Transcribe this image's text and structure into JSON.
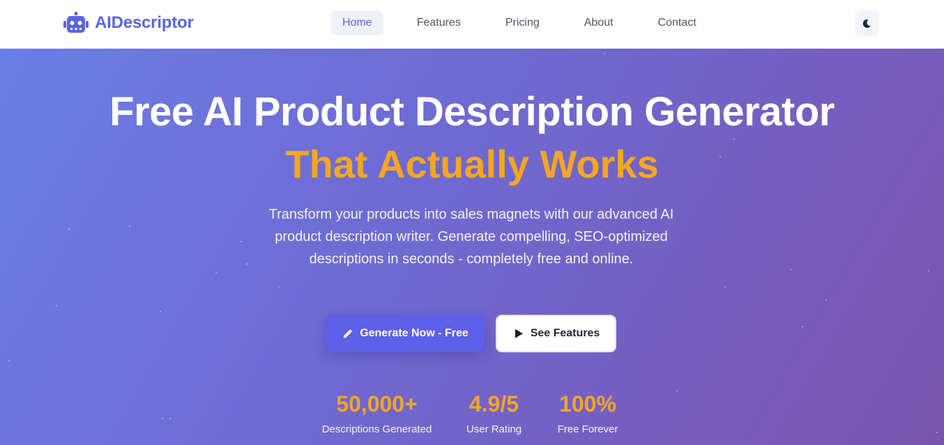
{
  "header": {
    "brand": {
      "name": "AIDescriptor",
      "icon": "robot-icon"
    },
    "nav": [
      {
        "label": "Home",
        "active": true
      },
      {
        "label": "Features",
        "active": false
      },
      {
        "label": "Pricing",
        "active": false
      },
      {
        "label": "About",
        "active": false
      },
      {
        "label": "Contact",
        "active": false
      }
    ],
    "theme_toggle": {
      "icon": "moon-icon"
    }
  },
  "hero": {
    "title": "Free AI Product Description Generator",
    "accent": "That Actually Works",
    "subtitle": "Transform your products into sales magnets with our advanced AI product description writer. Generate compelling, SEO-optimized descriptions in seconds - completely free and online.",
    "primary_button": {
      "label": "Generate Now - Free",
      "icon": "pencil-icon"
    },
    "secondary_button": {
      "label": "See Features",
      "icon": "play-icon"
    },
    "stats": [
      {
        "value": "50,000+",
        "label": "Descriptions Generated"
      },
      {
        "value": "4.9/5",
        "label": "User Rating"
      },
      {
        "value": "100%",
        "label": "Free Forever"
      }
    ]
  },
  "colors": {
    "brand": "#5b63e4",
    "accent": "#f5a623",
    "gradient_start": "#6a7ee6",
    "gradient_end": "#7a54b0",
    "primary_button": "#5d60e8"
  }
}
